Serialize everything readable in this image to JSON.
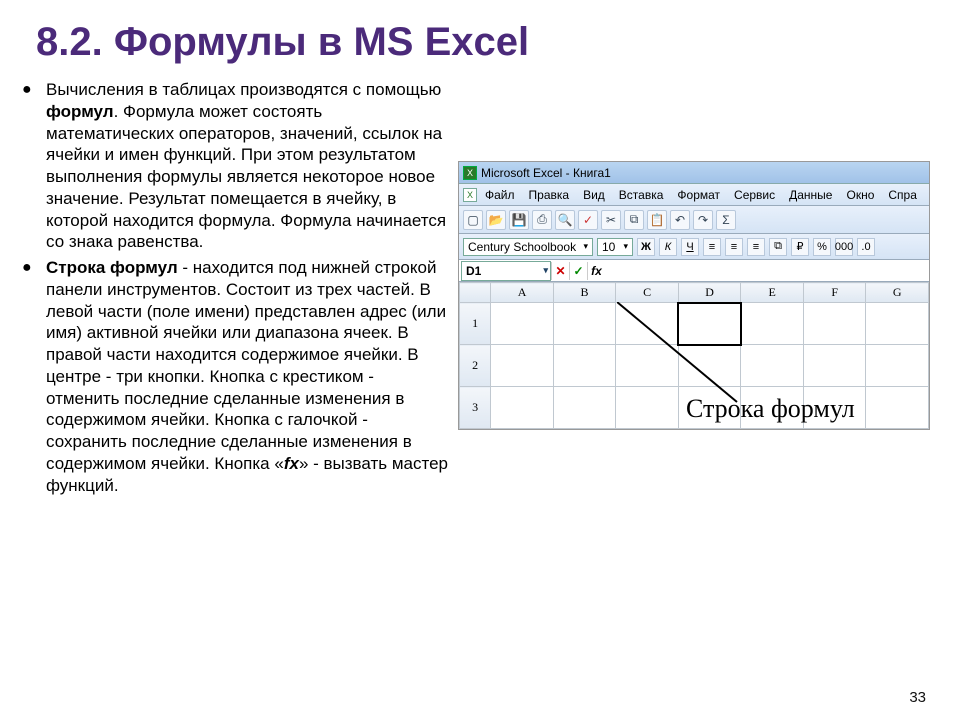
{
  "title": "8.2. Формулы в MS Excel",
  "bullets": [
    {
      "html": "Вычисления в таблицах производятся с помощью <b>формул</b>. Формула может состоять математических операторов, значений, ссылок на ячейки и имен функций. При этом результатом выполнения формулы является некоторое новое значение. Результат помещается в ячейку, в которой находится формула. Формула начинается со знака равенства."
    },
    {
      "html": "<b>Строка формул</b> - находится под нижней строкой панели инструментов. Состоит из трех частей. В левой части (поле имени) представлен адрес (или имя) активной ячейки или диапазона ячеек. В правой части находится содержимое ячейки. В центре - три кнопки. Кнопка с крестиком - отменить последние сделанные изменения в содержимом ячейки. Кнопка с галочкой - сохранить последние сделанные изменения в содержимом ячейки. Кнопка «<b><i>fx</i></b>» - вызвать мастер функций."
    }
  ],
  "excel": {
    "title": "Microsoft Excel - Книга1",
    "menu": [
      "Файл",
      "Правка",
      "Вид",
      "Вставка",
      "Формат",
      "Сервис",
      "Данные",
      "Окно",
      "Спра"
    ],
    "font_name": "Century Schoolbook",
    "font_size": "10",
    "name_box": "D1",
    "fx_cancel": "✕",
    "fx_enter": "✓",
    "fx_label": "fx",
    "columns": [
      "A",
      "B",
      "C",
      "D",
      "E",
      "F",
      "G"
    ],
    "rows": [
      "1",
      "2",
      "3"
    ]
  },
  "annotation": "Строка формул",
  "page_number": "33"
}
